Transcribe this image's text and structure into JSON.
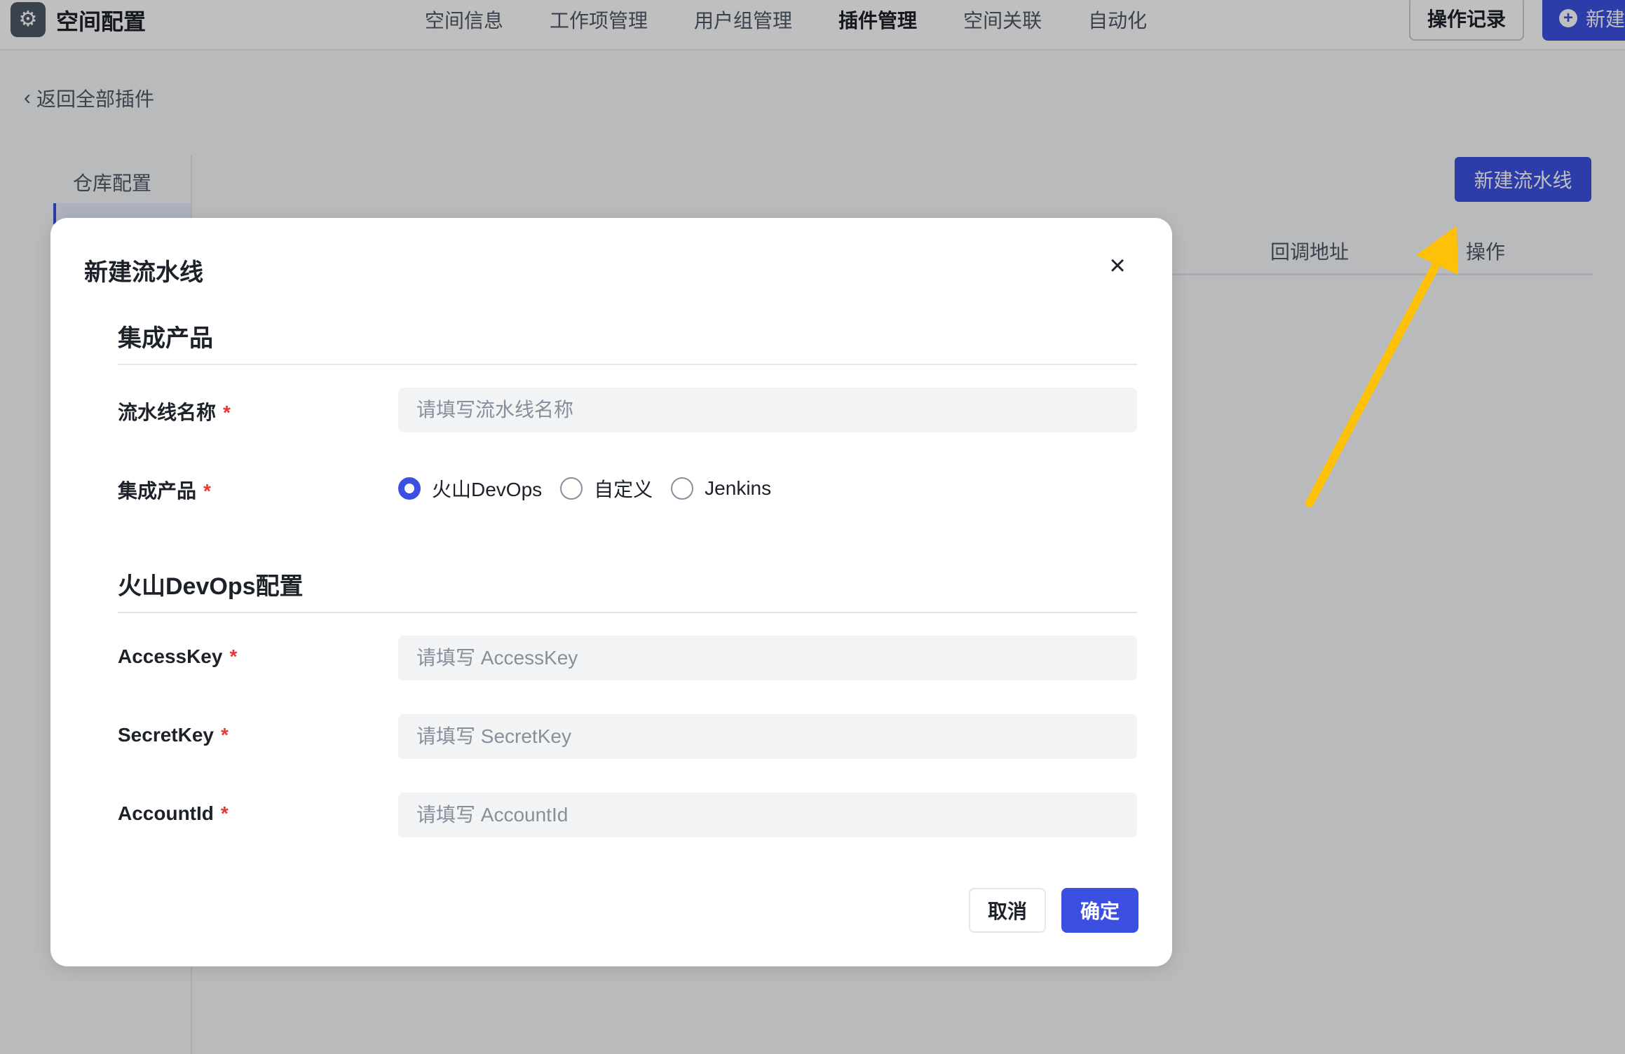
{
  "header": {
    "app_icon": "gear-icon",
    "title": "空间配置",
    "nav": [
      {
        "label": "空间信息",
        "active": false
      },
      {
        "label": "工作项管理",
        "active": false
      },
      {
        "label": "用户组管理",
        "active": false
      },
      {
        "label": "插件管理",
        "active": true
      },
      {
        "label": "空间关联",
        "active": false
      },
      {
        "label": "自动化",
        "active": false
      }
    ],
    "log_button": "操作记录",
    "new_button": "新建"
  },
  "page": {
    "back_link": "返回全部插件",
    "sidebar": [
      {
        "label": "仓库配置"
      }
    ],
    "new_pipeline_button": "新建流水线",
    "table_headers": [
      "回调地址",
      "操作"
    ]
  },
  "modal": {
    "title": "新建流水线",
    "sections": {
      "product": {
        "title": "集成产品",
        "name_label": "流水线名称",
        "name_placeholder": "请填写流水线名称",
        "product_label": "集成产品",
        "options": [
          "火山DevOps",
          "自定义",
          "Jenkins"
        ],
        "selected": "火山DevOps"
      },
      "config": {
        "title": "火山DevOps配置",
        "fields": [
          {
            "label": "AccessKey",
            "placeholder": "请填写 AccessKey"
          },
          {
            "label": "SecretKey",
            "placeholder": "请填写 SecretKey"
          },
          {
            "label": "AccountId",
            "placeholder": "请填写 AccountId"
          }
        ]
      }
    },
    "required_mark": "*",
    "cancel": "取消",
    "confirm": "确定"
  },
  "colors": {
    "primary": "#3b50e0",
    "required": "#e53935",
    "annotation_arrow": "#ffc107"
  }
}
